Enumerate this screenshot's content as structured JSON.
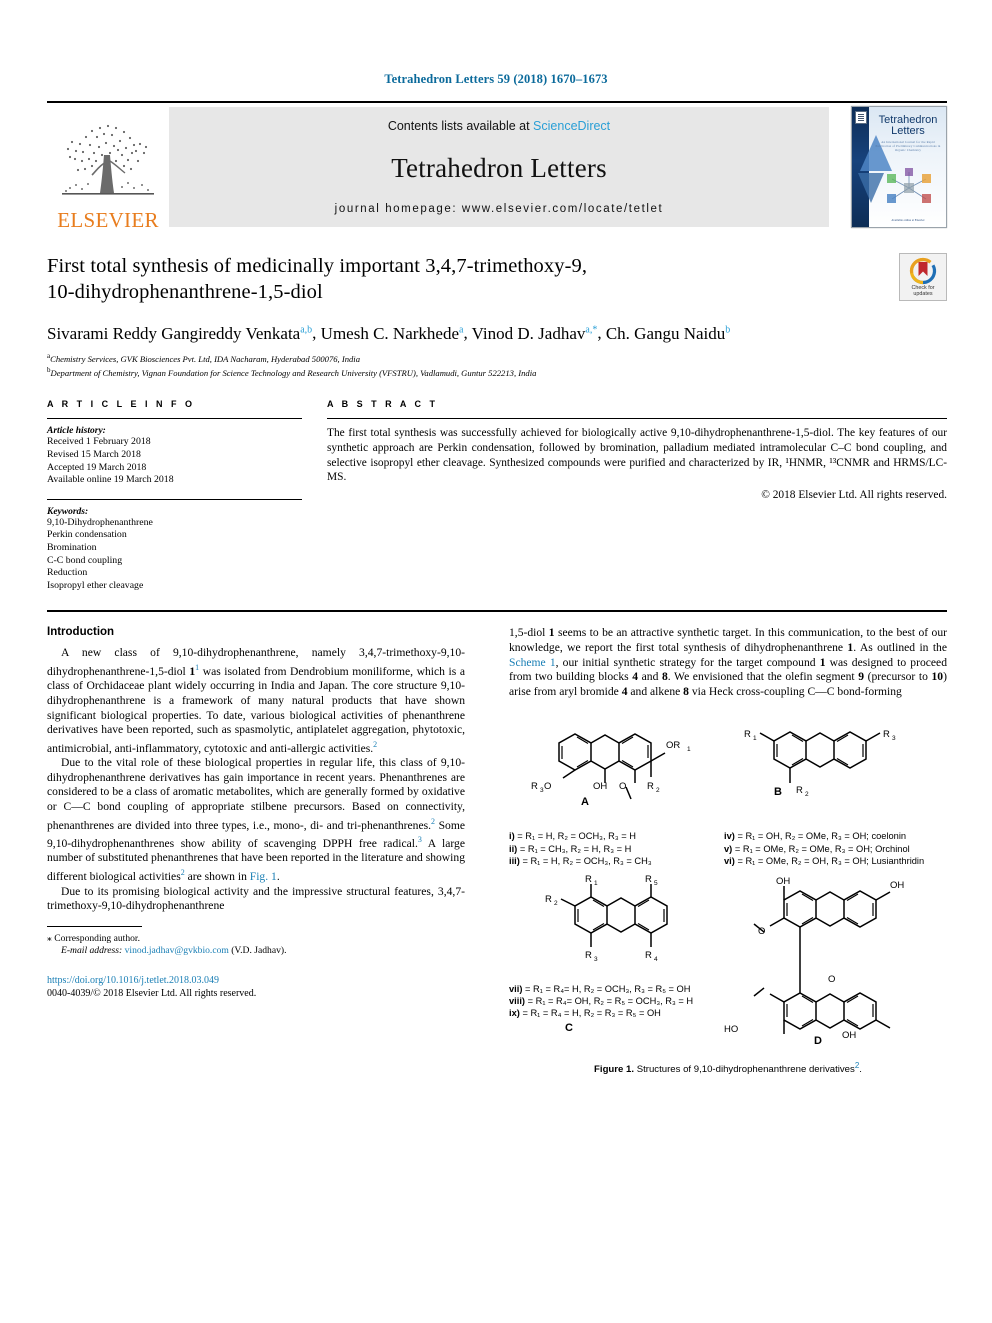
{
  "running_head": "Tetrahedron Letters 59 (2018) 1670–1673",
  "masthead": {
    "publisher": "ELSEVIER",
    "contents_prefix": "Contents lists available at ",
    "contents_link": "ScienceDirect",
    "journal_title": "Tetrahedron Letters",
    "homepage": "journal homepage: www.elsevier.com/locate/tetlet",
    "cover_title_line1": "Tetrahedron",
    "cover_title_line2": "Letters",
    "cover_sub": "An International Journal for the Rapid Publication of Preliminary Communications in Organic Chemistry",
    "cover_foot": "Available online at Elsevier"
  },
  "article": {
    "title_line1": "First total synthesis of medicinally important 3,4,7-trimethoxy-9,",
    "title_line2": "10-dihydrophenanthrene-1,5-diol",
    "crossmark_label_line1": "Check for",
    "crossmark_label_line2": "updates",
    "authors": [
      {
        "name": "Sivarami Reddy Gangireddy Venkata",
        "sup": "a,b",
        "sep": ", "
      },
      {
        "name": "Umesh C. Narkhede",
        "sup": "a",
        "sep": ", "
      },
      {
        "name": "Vinod D. Jadhav",
        "sup": "a,*",
        "sep": ", "
      },
      {
        "name": "Ch. Gangu Naidu",
        "sup": "b",
        "sep": ""
      }
    ],
    "affiliations": [
      {
        "sup": "a",
        "text": "Chemistry Services, GVK Biosciences Pvt. Ltd, IDA Nacharam, Hyderabad 500076, India"
      },
      {
        "sup": "b",
        "text": "Department of Chemistry, Vignan Foundation for Science Technology and Research University (VFSTRU), Vadlamudi, Guntur 522213, India"
      }
    ]
  },
  "article_info": {
    "heading": "A R T I C L E    I N F O",
    "history_label": "Article history:",
    "history": [
      "Received 1 February 2018",
      "Revised 15 March 2018",
      "Accepted 19 March 2018",
      "Available online 19 March 2018"
    ],
    "keywords_label": "Keywords:",
    "keywords": [
      "9,10-Dihydrophenanthrene",
      "Perkin condensation",
      "Bromination",
      "C-C bond coupling",
      "Reduction",
      "Isopropyl ether cleavage"
    ]
  },
  "abstract": {
    "heading": "A B S T R A C T",
    "text": "The first total synthesis was successfully achieved for biologically active 9,10-dihydrophenanthrene-1,5-diol. The key features of our synthetic approach are Perkin condensation, followed by bromination, palladium mediated intramolecular C–C bond coupling, and selective isopropyl ether cleavage. Synthesized compounds were purified and characterized by IR, ¹HNMR, ¹³CNMR and HRMS/LC-MS.",
    "copyright": "© 2018 Elsevier Ltd. All rights reserved."
  },
  "body": {
    "intro_heading": "Introduction",
    "p1_a": "A new class of 9,10-dihydrophenanthrene, namely 3,4,7-trimethoxy-9,10-dihydrophenanthrene-1,5-diol ",
    "p1_bold1": "1",
    "p1_sup1": "1",
    "p1_b": " was isolated from Dendrobium moniliforme, which is a class of Orchidaceae plant widely occurring in India and Japan. The core structure 9,10-dihydrophenanthrene is a framework of many natural products that have shown significant biological properties. To date, various biological activities of phenanthrene derivatives have been reported, such as spasmolytic, antiplatelet aggregation, phytotoxic, antimicrobial, anti-inflammatory, cytotoxic and anti-allergic activities.",
    "p1_sup2": "2",
    "p2_a": "Due to the vital role of these biological properties in regular life, this class of 9,10-dihydrophenanthrene derivatives has gain importance in recent years. Phenanthrenes are considered to be a class of aromatic metabolites, which are generally formed by oxidative or C—C bond coupling of appropriate stilbene precursors. Based on connectivity, phenanthrenes are divided into three types, i.e., mono-, di- and tri-phenanthrenes.",
    "p2_sup1": "2",
    "p2_b": " Some 9,10-dihydrophenanthrenes show ability of scavenging DPPH free radical.",
    "p2_sup2": "3",
    "p2_c": " A large number of substituted phenanthrenes that have been reported in the literature and showing different biological activities",
    "p2_sup3": "2",
    "p2_d": " are shown in ",
    "p2_link": "Fig. 1",
    "p2_e": ".",
    "p3": "Due to its promising biological activity and the impressive structural features, 3,4,7-trimethoxy-9,10-dihydrophenanthrene",
    "r1_a": "1,5-diol ",
    "r1_bold1": "1",
    "r1_b": " seems to be an attractive synthetic target. In this communication, to the best of our knowledge, we report the first total synthesis of dihydrophenanthrene ",
    "r1_bold2": "1",
    "r1_c": ". As outlined in the ",
    "r1_link": "Scheme 1",
    "r1_d": ", our initial synthetic strategy for the target compound ",
    "r1_bold3": "1",
    "r1_e": " was designed to proceed from two building blocks ",
    "r1_bold4": "4",
    "r1_f": " and ",
    "r1_bold5": "8",
    "r1_g": ". We envisioned that the olefin segment ",
    "r1_bold6": "9",
    "r1_h": " (precursor to ",
    "r1_bold7": "10",
    "r1_i": ") arise from aryl bromide ",
    "r1_bold8": "4",
    "r1_j": " and alkene ",
    "r1_bold9": "8",
    "r1_k": " via Heck cross-coupling C—C bond-forming"
  },
  "footnote": {
    "corresponding": "⁎ Corresponding author.",
    "email_label": "E-mail address:",
    "email": "vinod.jadhav@gvkbio.com",
    "email_suffix": " (V.D. Jadhav).",
    "doi": "https://doi.org/10.1016/j.tetlet.2018.03.049",
    "issn_line": "0040-4039/© 2018 Elsevier Ltd. All rights reserved."
  },
  "figure": {
    "caption_bold": "Figure 1.",
    "caption_text": " Structures of 9,10-dihydrophenanthrene derivatives",
    "caption_sup": "2",
    "caption_end": ".",
    "structures": [
      {
        "label": "A"
      },
      {
        "label": "B"
      },
      {
        "label": "C"
      },
      {
        "label": "D"
      }
    ],
    "labels_A": {
      "or1": "OR",
      "or1_sub": "1",
      "r3o": "R",
      "r3o_sub": "3",
      "r3o_tail": "O",
      "oh": "OH",
      "o": "O",
      "r2": "R",
      "r2_sub": "2"
    },
    "labels_B": {
      "r1": "R",
      "r1_sub": "1",
      "r3": "R",
      "r3_sub": "3",
      "r2": "R",
      "r2_sub": "2"
    },
    "labels_C": {
      "r1": "R",
      "r1_sub": "1",
      "r2": "R",
      "r2_sub": "2",
      "r3": "R",
      "r3_sub": "3",
      "r4": "R",
      "r4_sub": "4",
      "r5": "R",
      "r5_sub": "5"
    },
    "labels_D": {
      "oh": "OH",
      "ho": "HO",
      "o": "O"
    },
    "legend_left": [
      {
        "roman": "i)",
        "text": " = R₁ = H, R₂ = OCH₃, R₃ = H"
      },
      {
        "roman": "ii)",
        "text": " = R₁ = CH₃, R₂ = H, R₃ = H"
      },
      {
        "roman": "iii)",
        "text": " = R₁ = H, R₂ = OCH₃, R₃ = CH₃"
      }
    ],
    "legend_right": [
      {
        "roman": "iv)",
        "text": " = R₁ = OH, R₂ = OMe, R₃ = OH;  coelonin"
      },
      {
        "roman": "v)",
        "text": " = R₁ = OMe,  R₂ = OMe, R₃ = OH;  Orchinol"
      },
      {
        "roman": "vi)",
        "text": " = R₁ = OMe, R₂ = OH, R₃ = OH; Lusianthridin"
      }
    ],
    "legend_C": [
      {
        "roman": "vii)",
        "text": " = R₁ = R₄= H, R₂ = OCH₃, R₃ = R₅ = OH"
      },
      {
        "roman": "viii)",
        "text": " = R₁ = R₄= OH, R₂ = R₅ = OCH₃, R₃ = H"
      },
      {
        "roman": "ix)",
        "text": " = R₁ = R₄ = H, R₂ = R₃ = R₅ = OH"
      }
    ]
  },
  "colors": {
    "link": "#1a7fb5",
    "running_head": "#0b6a9b",
    "elsevier_orange": "#E87D1E",
    "sciencedirect": "#2a9fd6"
  }
}
